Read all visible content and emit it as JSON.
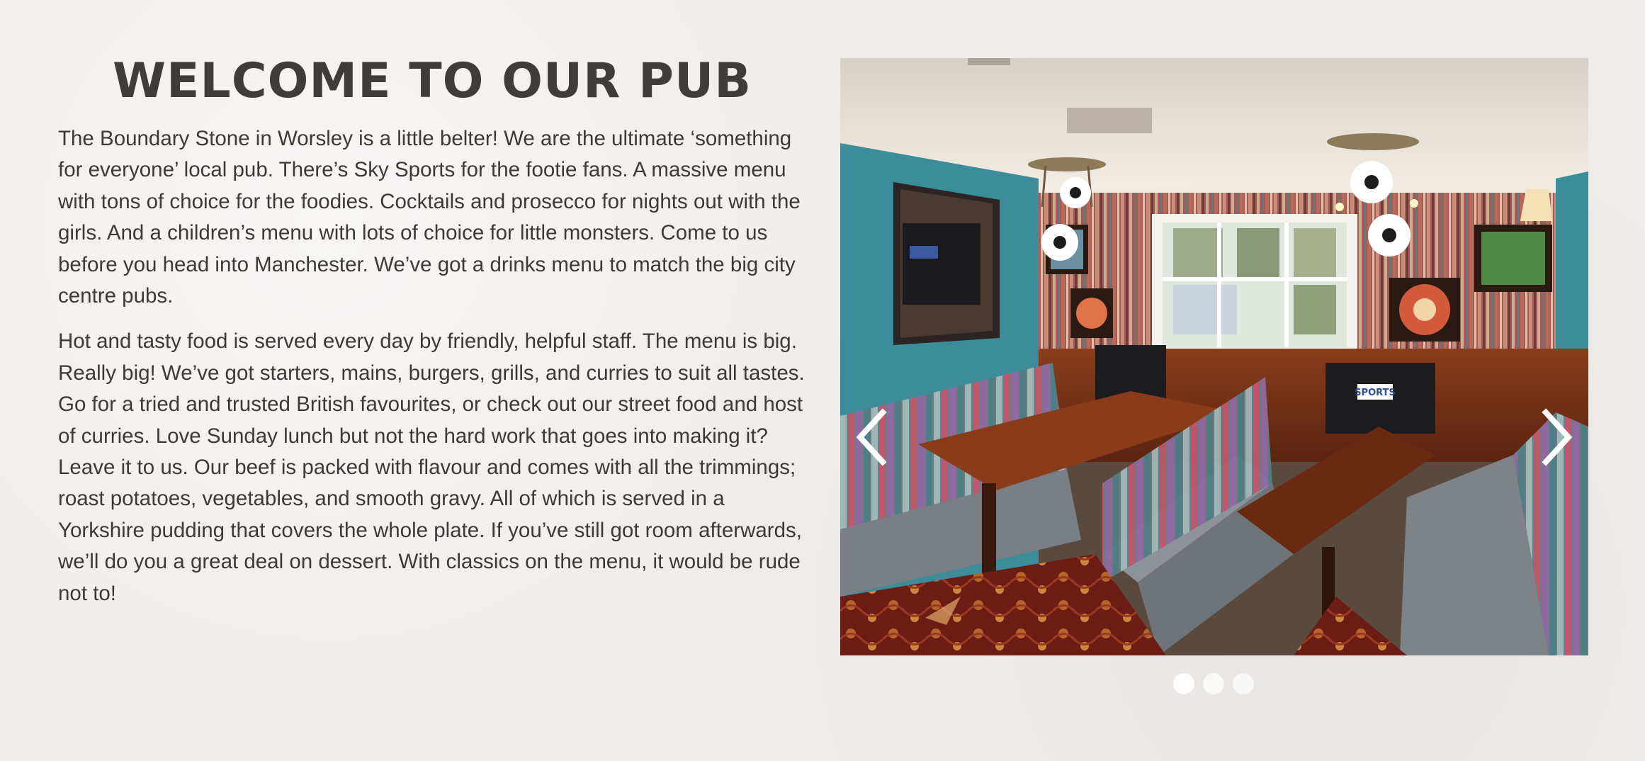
{
  "intro": {
    "title": "WELCOME TO OUR PUB",
    "paragraphs": [
      "The Boundary Stone in Worsley is a little belter! We are the ultimate ‘something for everyone’ local pub. There’s Sky Sports for the footie fans. A massive menu with tons of choice for the foodies. Cocktails and prosecco for nights out with the girls. And a children’s menu with lots of choice for little monsters. Come to us before you head into Manchester. We’ve got a drinks menu to match the big city centre pubs.",
      "Hot and tasty food is served every day by friendly, helpful staff. The menu is big. Really big! We’ve got starters, mains, burgers, grills, and curries to suit all tastes. Go for a tried and trusted British favourites, or check out our street food and host of curries. Love Sunday lunch but not the hard work that goes into making it? Leave it to us. Our beef is packed with flavour and comes with all the trimmings; roast potatoes, vegetables, and smooth gravy. All of which is served in a Yorkshire pudding that covers the whole plate. If you’ve still got room afterwards, we’ll do you a great deal on dessert. With classics on the menu, it would be rude not to!"
    ]
  },
  "slider": {
    "slide_count": 3,
    "active_index": 0,
    "prev_icon": "chevron-left-icon",
    "next_icon": "chevron-right-icon",
    "sign_text": "SPORTS"
  },
  "colors": {
    "background": "#efedeb",
    "text": "#3d3a36",
    "heading": "#3f3d3a",
    "dot": "#ffffff"
  }
}
